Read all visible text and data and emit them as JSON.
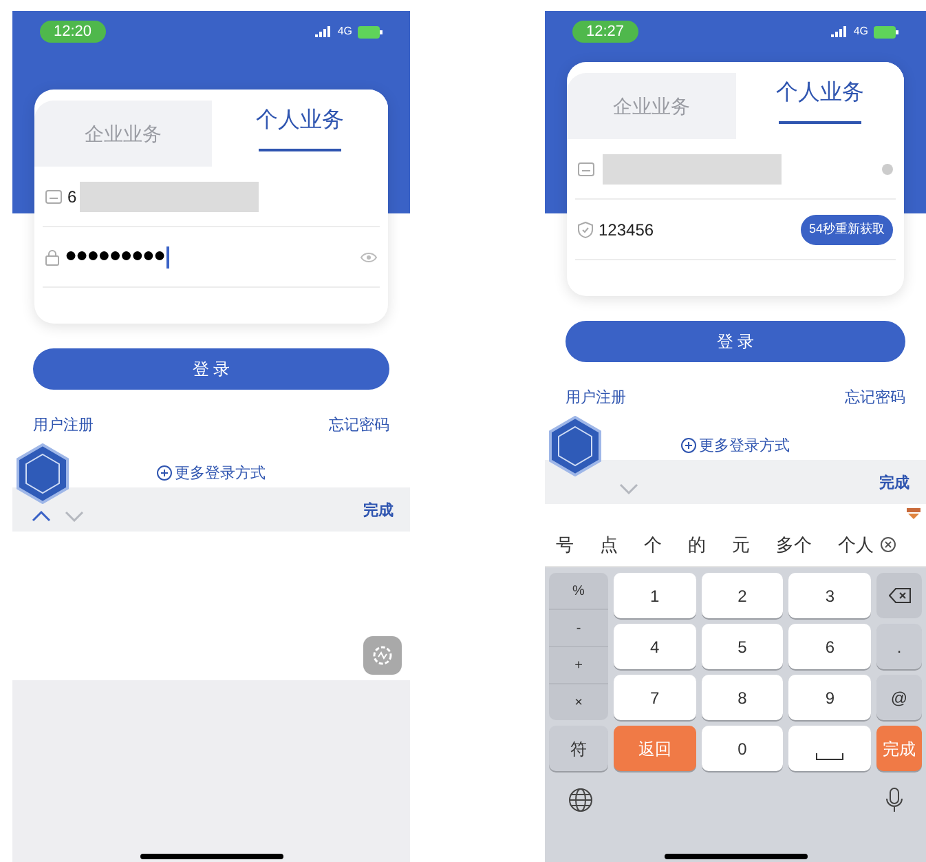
{
  "phones": [
    {
      "status": {
        "time": "12:20",
        "network": "4G"
      },
      "tabs": [
        {
          "label": "企业业务",
          "selected": false
        },
        {
          "label": "个人业务",
          "selected": true
        }
      ],
      "fields": [
        {
          "kind": "account",
          "value": "6",
          "redacted": true,
          "clear_button": false
        },
        {
          "kind": "password",
          "value": "●●●●●●●●●",
          "focused": true,
          "show_toggle": true
        }
      ],
      "login_button": "登 录",
      "register_link": "用户注册",
      "forgot_link": "忘记密码",
      "more_login": "更多登录方式",
      "toolbar": {
        "up_arrow": true,
        "done": "完成"
      },
      "keyboard": {
        "kind": "blank"
      }
    },
    {
      "status": {
        "time": "12:27",
        "network": "4G"
      },
      "tabs": [
        {
          "label": "企业业务",
          "selected": false
        },
        {
          "label": "个人业务",
          "selected": true
        }
      ],
      "fields": [
        {
          "kind": "account",
          "redacted": true,
          "clear_button": true
        },
        {
          "kind": "code",
          "value": "123456",
          "focused": false,
          "resend_button": "54秒重新获取"
        }
      ],
      "login_button": "登 录",
      "register_link": "用户注册",
      "forgot_link": "忘记密码",
      "more_login": "更多登录方式",
      "toolbar": {
        "up_arrow": false,
        "done": "完成"
      },
      "keyboard": {
        "kind": "numeric",
        "candidates": [
          "号",
          "点",
          "个",
          "的",
          "元",
          "多个",
          "个人"
        ],
        "symbol_keys": [
          "%",
          "-",
          "+",
          "×"
        ],
        "symbol_switch": "符",
        "digits": [
          "1",
          "2",
          "3",
          "4",
          "5",
          "6",
          "7",
          "8",
          "9"
        ],
        "back": "返回",
        "zero": "0",
        "side_keys": [
          ".",
          "@"
        ],
        "done": "完成"
      }
    }
  ]
}
